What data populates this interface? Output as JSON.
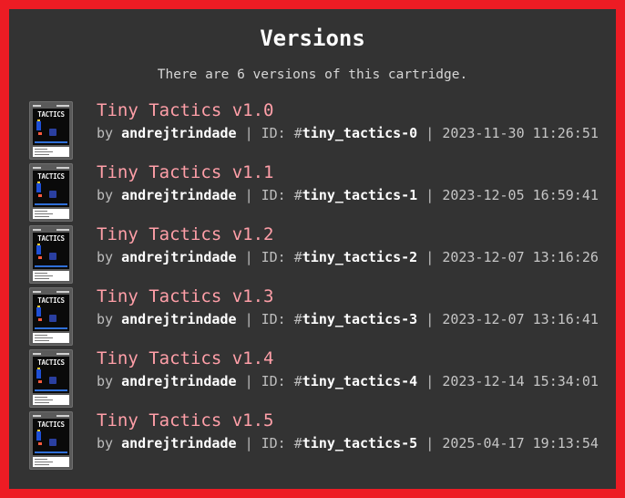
{
  "heading": "Versions",
  "summary": "There are 6 versions of this cartridge.",
  "labels": {
    "by": "by",
    "id_prefix": "ID: #",
    "separator": "|"
  },
  "cartridge_thumb_text": "TACTICS",
  "versions": [
    {
      "name": "Tiny Tactics v1.0",
      "author": "andrejtrindade",
      "id": "tiny_tactics-0",
      "date": "2023-11-30 11:26:51"
    },
    {
      "name": "Tiny Tactics v1.1",
      "author": "andrejtrindade",
      "id": "tiny_tactics-1",
      "date": "2023-12-05 16:59:41"
    },
    {
      "name": "Tiny Tactics v1.2",
      "author": "andrejtrindade",
      "id": "tiny_tactics-2",
      "date": "2023-12-07 13:16:26"
    },
    {
      "name": "Tiny Tactics v1.3",
      "author": "andrejtrindade",
      "id": "tiny_tactics-3",
      "date": "2023-12-07 13:16:41"
    },
    {
      "name": "Tiny Tactics v1.4",
      "author": "andrejtrindade",
      "id": "tiny_tactics-4",
      "date": "2023-12-14 15:34:01"
    },
    {
      "name": "Tiny Tactics v1.5",
      "author": "andrejtrindade",
      "id": "tiny_tactics-5",
      "date": "2025-04-17 19:13:54"
    }
  ],
  "colors": {
    "frame": "#ed1c24",
    "panel": "#333333",
    "version_name": "#ff9fa8",
    "meta_text": "#bdbdbd",
    "highlight": "#ffffff"
  }
}
